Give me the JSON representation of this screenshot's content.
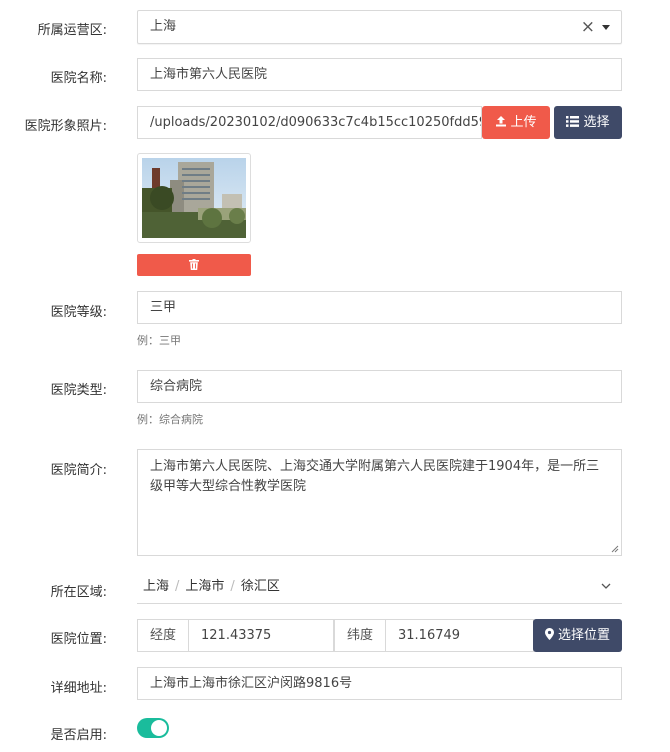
{
  "form": {
    "region": {
      "label": "所属运营区:",
      "value": "上海"
    },
    "name": {
      "label": "医院名称:",
      "value": "上海市第六人民医院"
    },
    "photo": {
      "label": "医院形象照片:",
      "path": "/uploads/20230102/d090633c7c4b15cc10250fdd5955c6",
      "upload_label": "上传",
      "choose_label": "选择"
    },
    "grade": {
      "label": "医院等级:",
      "value": "三甲",
      "hint": "例：三甲"
    },
    "type": {
      "label": "医院类型:",
      "value": "综合病院",
      "hint": "例：综合病院"
    },
    "intro": {
      "label": "医院简介:",
      "value": "上海市第六人民医院、上海交通大学附属第六人民医院建于1904年，是一所三级甲等大型综合性教学医院"
    },
    "area": {
      "label": "所在区域:",
      "province": "上海",
      "city": "上海市",
      "district": "徐汇区"
    },
    "location": {
      "label": "医院位置:",
      "lng_label": "经度",
      "lng": "121.43375",
      "lat_label": "纬度",
      "lat": "31.16749",
      "pick_label": "选择位置"
    },
    "address": {
      "label": "详细地址:",
      "value": "上海市上海市徐汇区沪闵路9816号"
    },
    "enabled": {
      "label": "是否启用:",
      "on": true
    }
  },
  "colors": {
    "danger": "#f05a4a",
    "navy": "#3f4a68",
    "toggle": "#1abc9c"
  }
}
